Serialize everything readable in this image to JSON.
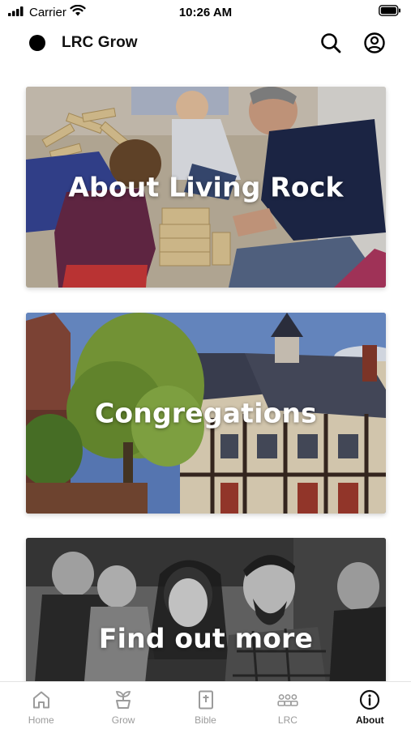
{
  "status_bar": {
    "carrier": "Carrier",
    "time": "10:26 AM"
  },
  "header": {
    "title": "LRC Grow",
    "icons": [
      "logo-dot",
      "search-icon",
      "account-icon"
    ]
  },
  "cards": [
    {
      "title": "About Living Rock"
    },
    {
      "title": "Congregations"
    },
    {
      "title": "Find out more"
    }
  ],
  "tabs": [
    {
      "label": "Home",
      "icon": "home-icon",
      "active": false
    },
    {
      "label": "Grow",
      "icon": "sprout-icon",
      "active": false
    },
    {
      "label": "Bible",
      "icon": "bible-icon",
      "active": false
    },
    {
      "label": "LRC",
      "icon": "people-icon",
      "active": false
    },
    {
      "label": "About",
      "icon": "info-icon",
      "active": true
    }
  ],
  "colors": {
    "active_tab": "#111111",
    "inactive_tab": "#9b9b9b",
    "background": "#ffffff"
  }
}
